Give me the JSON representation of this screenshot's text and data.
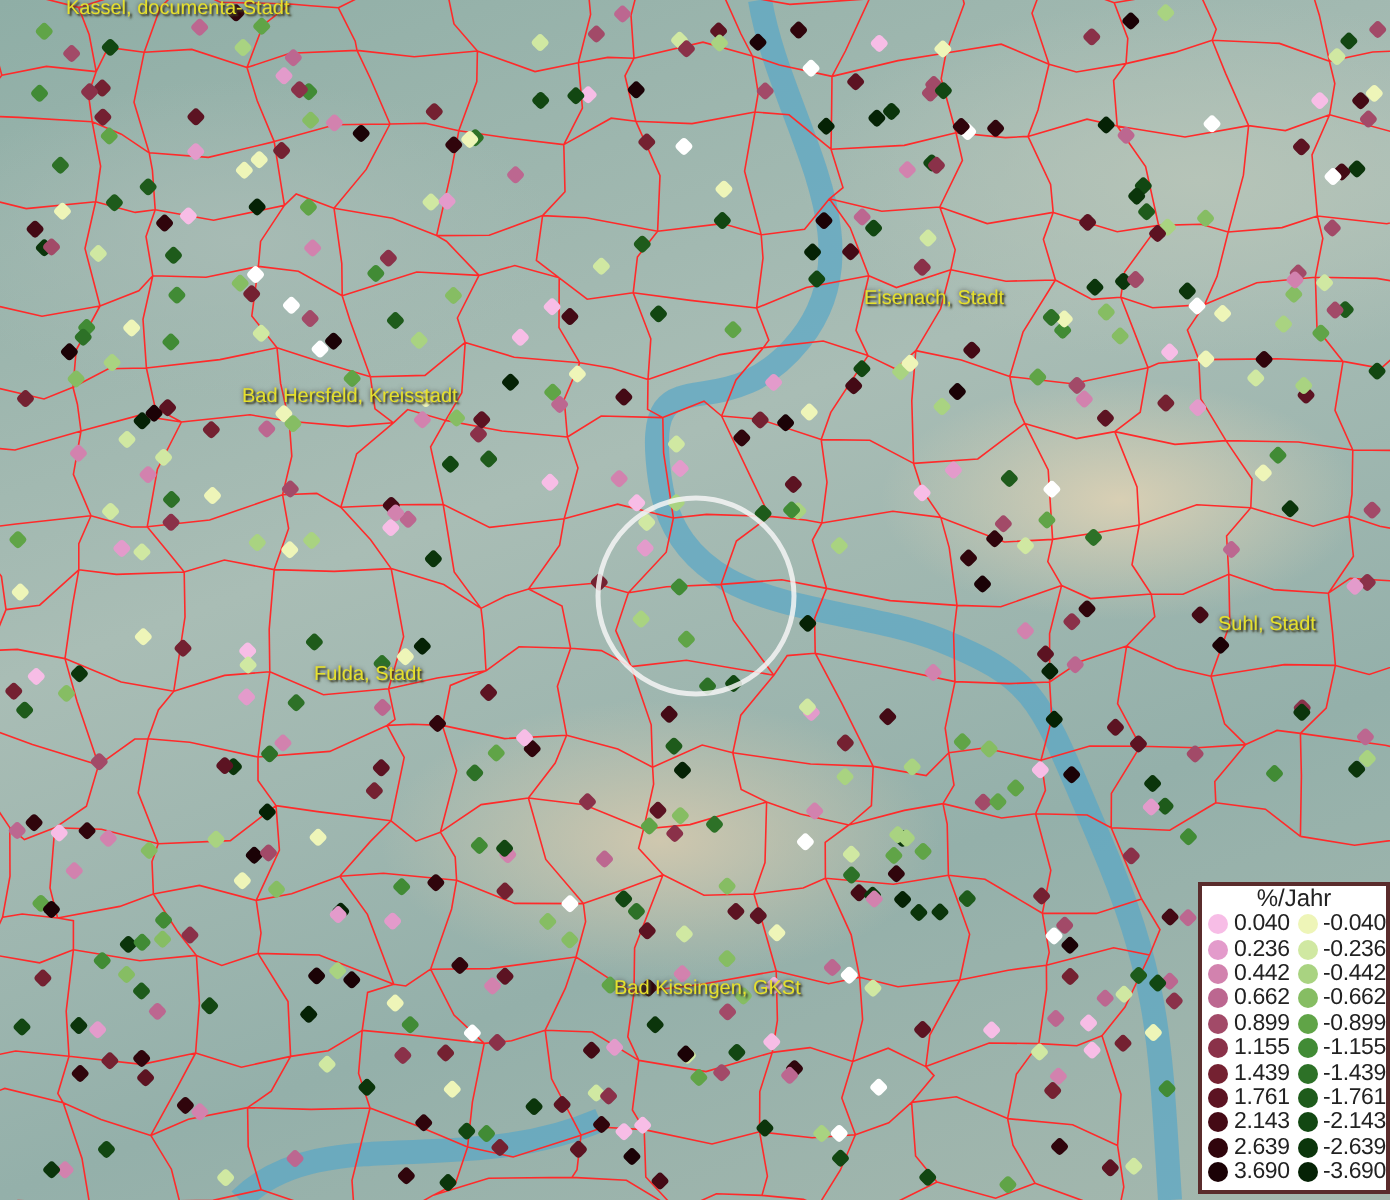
{
  "map": {
    "places": [
      {
        "name": "Kassel, documenta-Stadt"
      },
      {
        "name": "Eisenach, Stadt"
      },
      {
        "name": "Bad Hersfeld, Kreisstadt"
      },
      {
        "name": "Fulda, Stadt"
      },
      {
        "name": "Suhl, Stadt"
      },
      {
        "name": "Bad Kissingen, GKSt"
      }
    ]
  },
  "legend": {
    "title": "%/Jahr",
    "items": [
      {
        "label": "0.040",
        "color": "#f7bde6"
      },
      {
        "label": "-0.040",
        "color": "#eef5b8"
      },
      {
        "label": "0.236",
        "color": "#e39bcb"
      },
      {
        "label": "-0.236",
        "color": "#d0e8a2"
      },
      {
        "label": "0.442",
        "color": "#d282ae"
      },
      {
        "label": "-0.442",
        "color": "#a9d381"
      },
      {
        "label": "0.662",
        "color": "#bc6790"
      },
      {
        "label": "-0.662",
        "color": "#86bd63"
      },
      {
        "label": "0.899",
        "color": "#a24a68"
      },
      {
        "label": "-0.899",
        "color": "#60a447"
      },
      {
        "label": "1.155",
        "color": "#8a3149"
      },
      {
        "label": "-1.155",
        "color": "#418b35"
      },
      {
        "label": "1.439",
        "color": "#742131"
      },
      {
        "label": "-1.439",
        "color": "#2d7127"
      },
      {
        "label": "1.761",
        "color": "#5c1322"
      },
      {
        "label": "-1.761",
        "color": "#1e5b1b"
      },
      {
        "label": "2.143",
        "color": "#440a15"
      },
      {
        "label": "-2.143",
        "color": "#124712"
      },
      {
        "label": "2.639",
        "color": "#30050c"
      },
      {
        "label": "-2.639",
        "color": "#0b350b"
      },
      {
        "label": "3.690",
        "color": "#1b0206"
      },
      {
        "label": "-3.690",
        "color": "#052205"
      }
    ]
  }
}
